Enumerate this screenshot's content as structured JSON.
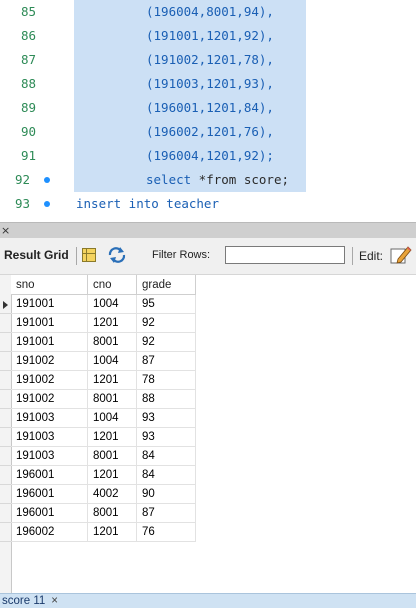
{
  "editor": {
    "lines": [
      {
        "number": "85",
        "text": "(196004,8001,94),"
      },
      {
        "number": "86",
        "text": "(191001,1201,92),"
      },
      {
        "number": "87",
        "text": "(191002,1201,78),"
      },
      {
        "number": "88",
        "text": "(191003,1201,93),"
      },
      {
        "number": "89",
        "text": "(196001,1201,84),"
      },
      {
        "number": "90",
        "text": "(196002,1201,76),"
      },
      {
        "number": "91",
        "text": "(196004,1201,92);"
      },
      {
        "number": "92",
        "keyword": "select",
        "rest": " *from score;"
      },
      {
        "number": "93",
        "text": "insert into teacher"
      }
    ]
  },
  "splitter": {
    "close_glyph": "×"
  },
  "toolbar": {
    "title": "Result Grid",
    "filter_label": "Filter Rows:",
    "filter_value": "",
    "edit_label": "Edit:"
  },
  "grid": {
    "columns": [
      "sno",
      "cno",
      "grade"
    ],
    "rows": [
      [
        "191001",
        "1004",
        "95"
      ],
      [
        "191001",
        "1201",
        "92"
      ],
      [
        "191001",
        "8001",
        "92"
      ],
      [
        "191002",
        "1004",
        "87"
      ],
      [
        "191002",
        "1201",
        "78"
      ],
      [
        "191002",
        "8001",
        "88"
      ],
      [
        "191003",
        "1004",
        "93"
      ],
      [
        "191003",
        "1201",
        "93"
      ],
      [
        "191003",
        "8001",
        "84"
      ],
      [
        "196001",
        "1201",
        "84"
      ],
      [
        "196001",
        "4002",
        "90"
      ],
      [
        "196001",
        "8001",
        "87"
      ],
      [
        "196002",
        "1201",
        "76"
      ]
    ]
  },
  "tabs": [
    {
      "label": "score 11",
      "close_glyph": "×"
    }
  ],
  "colors": {
    "selection": "#cce0f5",
    "line_number": "#2e8b57",
    "sql_keyword": "#1a5fb4",
    "tab_bar": "#cfe2f3"
  }
}
